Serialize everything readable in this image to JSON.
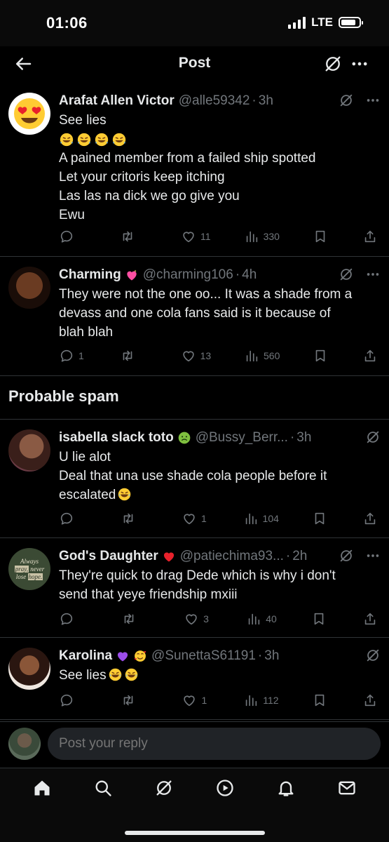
{
  "status": {
    "time": "01:06",
    "network": "LTE"
  },
  "header": {
    "title": "Post"
  },
  "replies": [
    {
      "name": "Arafat Allen Victor",
      "handle": "@alle59342",
      "sep": "·",
      "age": "3h",
      "avatar_icon": "heart-eyes-emoji-icon",
      "lines": [
        "See lies",
        "A pained member from a failed ship spotted",
        "Let your critoris keep itching",
        "Las las na dick we go give you",
        "Ewu"
      ],
      "emoji_line": "rofl-emoji-icon x4",
      "stats": {
        "replies": "",
        "reposts": "",
        "likes": "11",
        "views": "330"
      }
    },
    {
      "name": "Charming",
      "name_emoji": "sparkling-heart-icon",
      "handle": "@charming106",
      "sep": "·",
      "age": "4h",
      "lines": [
        "They were not the one oo... It was a shade from a",
        "devass and one cola fans said is it because of",
        "blah blah"
      ],
      "stats": {
        "replies": "1",
        "reposts": "",
        "likes": "13",
        "views": "560"
      }
    },
    {
      "name": "isabella slack toto",
      "name_emoji": "nauseated-face-icon",
      "handle": "@Bussy_Berr...",
      "sep": "·",
      "age": "3h",
      "lines": [
        "U lie alot",
        "Deal that una use shade cola people before it",
        "escalated"
      ],
      "stats": {
        "replies": "",
        "reposts": "",
        "likes": "1",
        "views": "104"
      }
    },
    {
      "name": "God's Daughter",
      "name_emoji": "red-heart-icon",
      "handle": "@patiechima93...",
      "sep": "·",
      "age": "2h",
      "avatar_text": {
        "l1": "Always",
        "l2": "pray,",
        "l2b": "never",
        "l3": "lose",
        "l3b": "hope."
      },
      "lines": [
        "They're quick to drag Dede which is why i don't",
        "send that yeye friendship mxiii"
      ],
      "stats": {
        "replies": "",
        "reposts": "",
        "likes": "3",
        "views": "40"
      }
    },
    {
      "name": "Karolina",
      "name_emoji": "purple-heart-and-smiling-hearts-icon",
      "handle": "@SunettaS61191",
      "sep": "·",
      "age": "3h",
      "lines": [
        "See lies"
      ],
      "stats": {
        "replies": "",
        "reposts": "",
        "likes": "1",
        "views": "112"
      }
    }
  ],
  "section": {
    "probable_spam": "Probable spam"
  },
  "composer": {
    "placeholder": "Post your reply"
  },
  "colors": {
    "background": "#000000",
    "text": "#e7e9ea",
    "muted": "#71767b",
    "divider": "#2f3336",
    "input_bg": "#202327"
  }
}
